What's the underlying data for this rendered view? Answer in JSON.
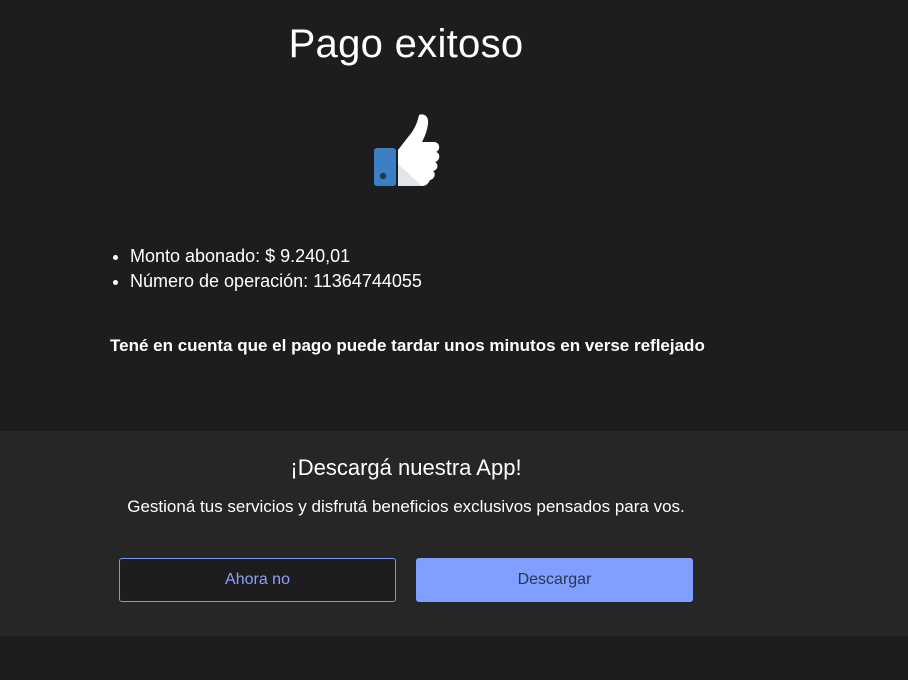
{
  "header": {
    "title": "Pago exitoso"
  },
  "icons": {
    "success": "thumbs-up-icon"
  },
  "payment": {
    "amount_label": "Monto abonado: $ 9.240,01",
    "operation_label": "Número de operación: 11364744055"
  },
  "note": "Tené en cuenta que el pago puede tardar unos minutos en verse reflejado",
  "app_banner": {
    "title": "¡Descargá nuestra App!",
    "text": "Gestioná tus servicios y disfrutá beneficios exclusivos pensados para vos.",
    "dismiss_label": "Ahora no",
    "download_label": "Descargar"
  },
  "colors": {
    "background": "#1d1d1f",
    "banner_background": "#262626",
    "accent": "#7fa0ff",
    "thumb_cuff": "#3a7fc1"
  }
}
